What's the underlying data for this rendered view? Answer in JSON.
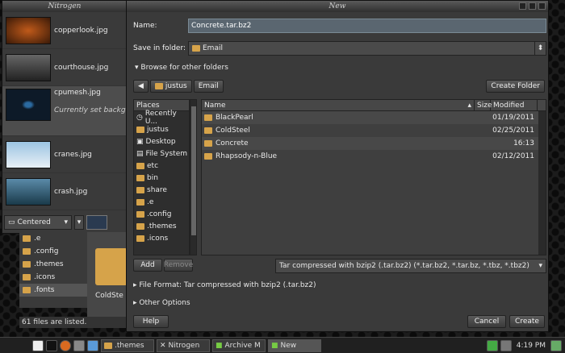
{
  "nitrogen": {
    "title": "Nitrogen",
    "wallpapers": [
      {
        "name": "copperlook.jpg",
        "color": "#5a2a10"
      },
      {
        "name": "courthouse.jpg",
        "color": "#888"
      },
      {
        "name": "cpumesh.jpg",
        "color": "#16324a",
        "current": "Currently set backg"
      },
      {
        "name": "cranes.jpg",
        "color": "#6ea2c8"
      },
      {
        "name": "crash.jpg",
        "color": "#3a6f8a"
      }
    ],
    "mode": "Centered"
  },
  "filemanager": {
    "places": [
      ".e",
      ".config",
      ".themes",
      ".icons",
      ".fonts"
    ],
    "selected_place": ".fonts",
    "folder_label": "ColdSte",
    "status": "61 files are listed."
  },
  "dialog": {
    "title": "New",
    "name_label": "Name:",
    "name_value": "Concrete.tar.bz2",
    "save_label": "Save in folder:",
    "save_value": "Email",
    "browse_label": "Browse for other folders",
    "path": [
      "justus",
      "Email"
    ],
    "create_folder": "Create Folder",
    "places_header": "Places",
    "places": [
      "Recently U...",
      "justus",
      "Desktop",
      "File System",
      "etc",
      "bin",
      "share",
      ".e",
      ".config",
      ".themes",
      ".icons"
    ],
    "columns": {
      "name": "Name",
      "size": "Size",
      "modified": "Modified"
    },
    "files": [
      {
        "name": "BlackPearl",
        "modified": "01/19/2011"
      },
      {
        "name": "ColdSteel",
        "modified": "02/25/2011"
      },
      {
        "name": "Concrete",
        "modified": "16:13"
      },
      {
        "name": "Rhapsody-n-Blue",
        "modified": "02/12/2011"
      }
    ],
    "add": "Add",
    "remove": "Remove",
    "filter": "Tar compressed with bzip2 (.tar.bz2) (*.tar.bz2, *.tar.bz, *.tbz, *.tbz2)",
    "format_label": "File Format: Tar compressed with bzip2 (.tar.bz2)",
    "other_options": "Other Options",
    "help": "Help",
    "cancel": "Cancel",
    "create": "Create"
  },
  "taskbar": {
    "tasks": [
      ".themes",
      "Nitrogen",
      "Archive M",
      "New"
    ],
    "clock": "4:19 PM"
  }
}
